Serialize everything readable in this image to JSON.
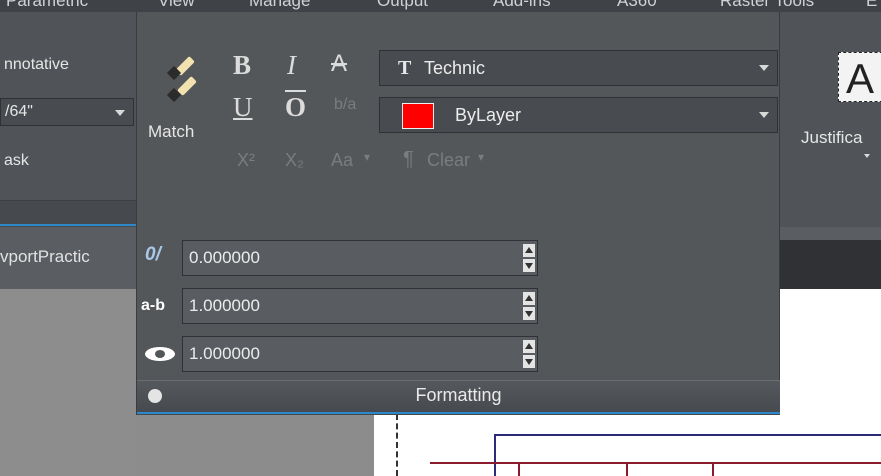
{
  "menu": [
    "Parametric",
    "View",
    "Manage",
    "Output",
    "Add-ins",
    "A360",
    "Raster Tools",
    "E"
  ],
  "left_panel": {
    "annotative": "nnotative",
    "height": "/64\"",
    "mask": "ask"
  },
  "match": {
    "label": "Match"
  },
  "format_buttons": {
    "bold": "B",
    "italic": "I",
    "strike": "A",
    "underline": "U",
    "overline": "O",
    "superscript": "X²",
    "subscript": "X₂",
    "case": "Aa",
    "clear": "Clear"
  },
  "font": {
    "icon": "T",
    "value": "Technic"
  },
  "color": {
    "value": "ByLayer",
    "swatch": "#ff0000"
  },
  "oblique": {
    "icon": "0/",
    "value": "0.000000"
  },
  "tracking": {
    "icon": "a-b",
    "value": "1.000000"
  },
  "width_factor": {
    "value": "1.000000"
  },
  "formatting_title": "Formatting",
  "justify": {
    "label": "Justifica"
  },
  "tab": {
    "name": "vportPractic"
  }
}
